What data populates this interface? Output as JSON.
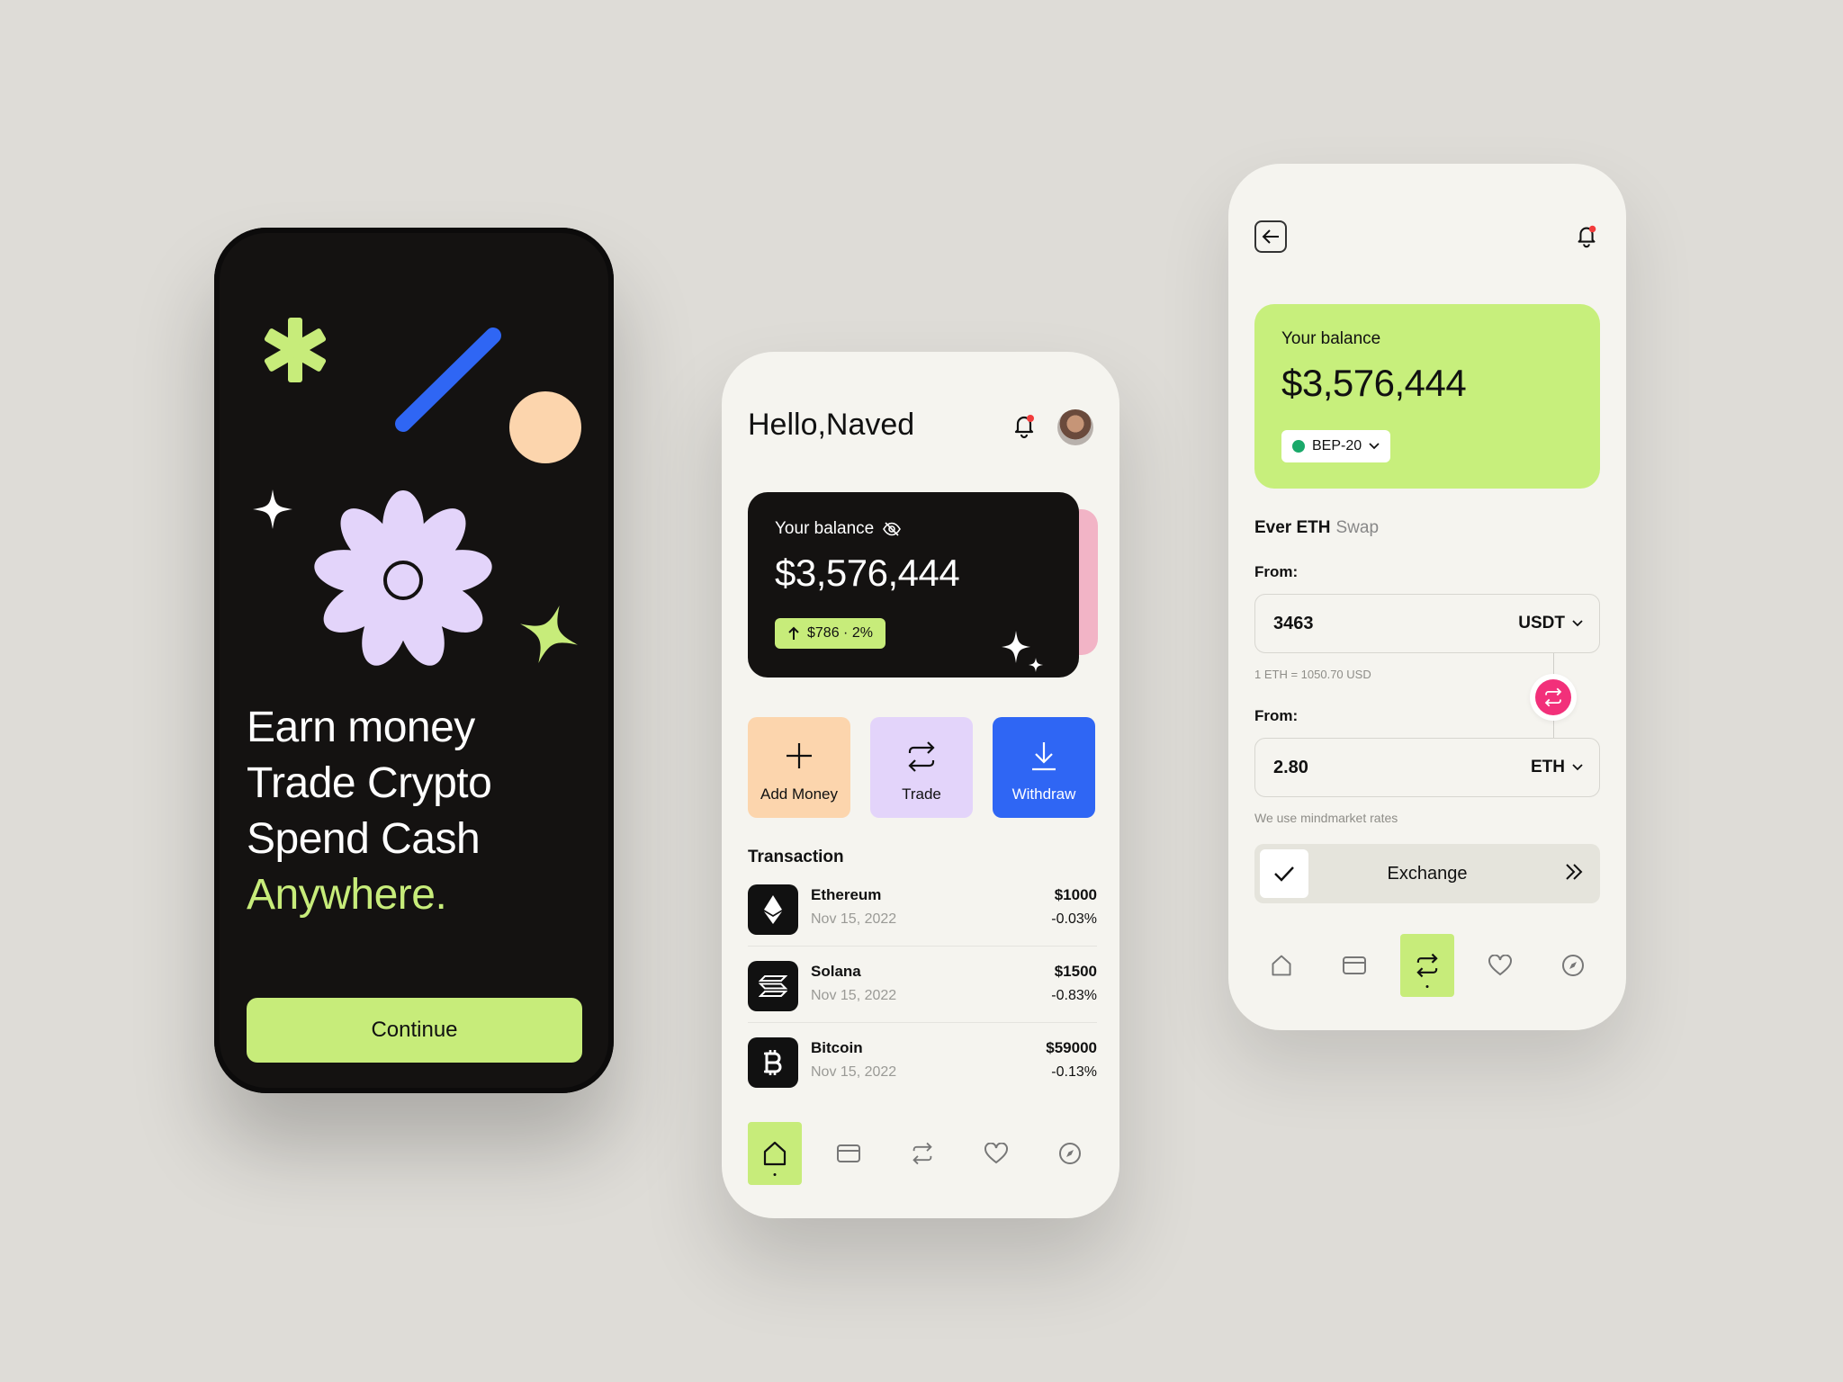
{
  "onboarding": {
    "headline_lines": [
      "Earn money",
      "Trade Crypto",
      "Spend Cash"
    ],
    "headline_accent": "Anywhere.",
    "continue_label": "Continue",
    "colors": {
      "background": "#141211",
      "accent": "#c7ec7a",
      "flower": "#e3d4fa",
      "stroke": "#2f66f4",
      "circle": "#fcd5ad"
    }
  },
  "home": {
    "greeting": "Hello,Naved",
    "balance_label": "Your balance",
    "balance": "$3,576,444",
    "change": "$786 · 2%",
    "actions": [
      {
        "label": "Add Money",
        "icon": "plus-icon"
      },
      {
        "label": "Trade",
        "icon": "swap-icon"
      },
      {
        "label": "Withdraw",
        "icon": "download-icon"
      }
    ],
    "section_title": "Transaction",
    "transactions": [
      {
        "name": "Ethereum",
        "date": "Nov 15, 2022",
        "amount": "$1000",
        "change": "-0.03%",
        "icon": "ethereum-icon"
      },
      {
        "name": "Solana",
        "date": "Nov 15, 2022",
        "amount": "$1500",
        "change": "-0.83%",
        "icon": "solana-icon"
      },
      {
        "name": "Bitcoin",
        "date": "Nov 15, 2022",
        "amount": "$59000",
        "change": "-0.13%",
        "icon": "bitcoin-icon"
      }
    ],
    "nav": [
      "home-icon",
      "card-icon",
      "swap-icon",
      "heart-icon",
      "compass-icon"
    ],
    "nav_active": "home-icon"
  },
  "swap": {
    "balance_label": "Your balance",
    "balance": "$3,576,444",
    "network": "BEP-20",
    "title_bold": "Ever ETH",
    "title_light": "Swap",
    "from_label_1": "From:",
    "from_value_1": "3463",
    "from_currency_1": "USDT",
    "rate": "1 ETH = 1050.70 USD",
    "from_label_2": "From:",
    "from_value_2": "2.80",
    "from_currency_2": "ETH",
    "note": "We use mindmarket rates",
    "exchange_label": "Exchange",
    "nav": [
      "home-icon",
      "card-icon",
      "swap-icon",
      "heart-icon",
      "compass-icon"
    ],
    "nav_active": "swap-icon",
    "colors": {
      "card": "#c7ef7c",
      "swap_button": "#f2307a",
      "network_dot": "#1aa96a"
    }
  }
}
